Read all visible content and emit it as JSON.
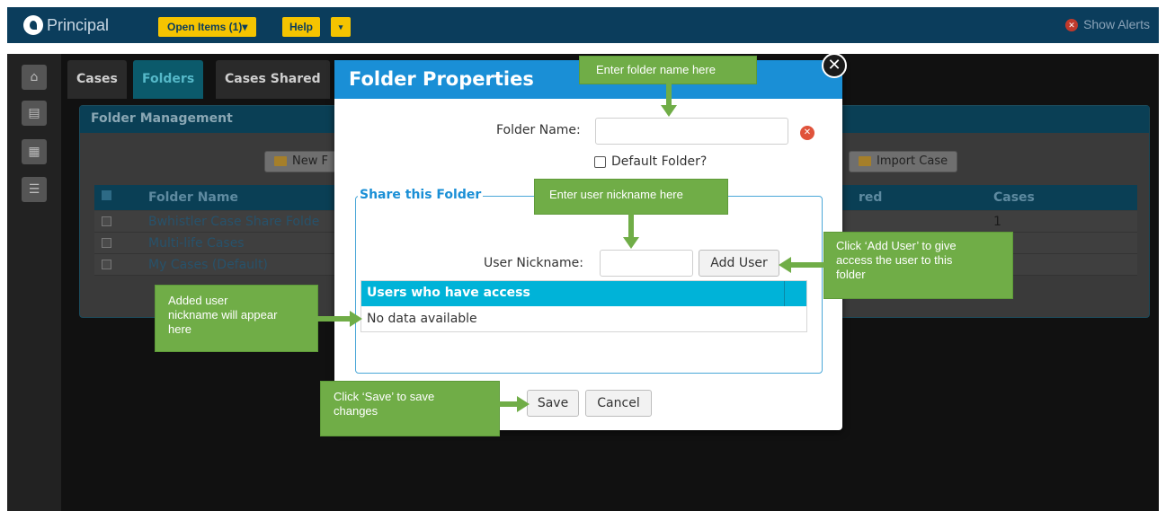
{
  "topbar": {
    "brand": "Principal",
    "open_items": "Open Items (1)▾",
    "help": "Help",
    "help_caret": "▾",
    "alerts_icon": "✕",
    "alerts": "Show Alerts"
  },
  "tabs": [
    "Cases",
    "Folders",
    "Cases Shared"
  ],
  "panel": {
    "title": "Folder Management",
    "new_folder": "New F",
    "import_case": "Import Case",
    "columns": [
      "Folder Name",
      "red",
      "Cases"
    ],
    "rows": [
      {
        "name": "Bwhistler Case Share Folde",
        "cases": "1"
      },
      {
        "name": "Multi-life Cases",
        "cases": ""
      },
      {
        "name": "My Cases (Default)",
        "cases": ""
      }
    ]
  },
  "modal": {
    "title": "Folder Properties",
    "close_icon": "✕",
    "folder_name_label": "Folder Name:",
    "folder_name_value": "",
    "clear_icon": "✕",
    "default_folder_label": "Default Folder?",
    "share_legend": "Share this Folder",
    "user_nickname_label": "User Nickname:",
    "user_nickname_value": "",
    "add_user": "Add User",
    "access_header": "Users who have access",
    "access_empty": "No data available",
    "save": "Save",
    "cancel": "Cancel"
  },
  "callouts": {
    "folder_name": "Enter folder name here",
    "nickname": "Enter user nickname here",
    "add_user": [
      "Click ‘Add User’ to give",
      "access the user to this",
      "folder"
    ],
    "added_user": [
      "Added user",
      "nickname will appear",
      "here"
    ],
    "save": [
      "Click ‘Save’ to save",
      "changes"
    ]
  },
  "colors": {
    "modal_header": "#1a8fd6",
    "access_header": "#00b3d8",
    "callout": "#70ad47",
    "topbar": "#0b3d5c"
  }
}
